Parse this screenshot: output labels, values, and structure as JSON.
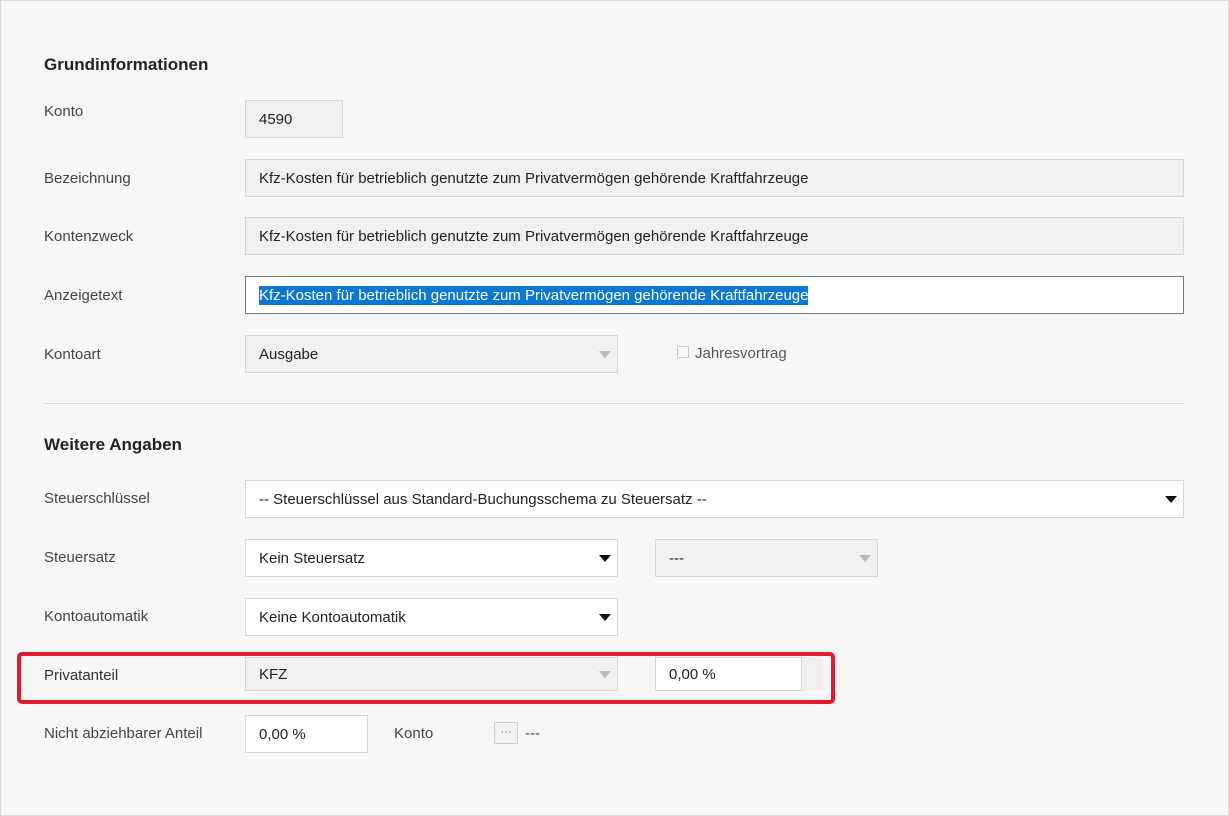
{
  "sections": {
    "grund": "Grundinformationen",
    "weitere": "Weitere Angaben"
  },
  "grund": {
    "konto": {
      "label": "Konto",
      "value": "4590"
    },
    "bezeichnung": {
      "label": "Bezeichnung",
      "value": "Kfz-Kosten für betrieblich genutzte zum Privatvermögen gehörende Kraftfahrzeuge"
    },
    "kontenzweck": {
      "label": "Kontenzweck",
      "value": "Kfz-Kosten für betrieblich genutzte zum Privatvermögen gehörende Kraftfahrzeuge"
    },
    "anzeigetext": {
      "label": "Anzeigetext",
      "value": "Kfz-Kosten für betrieblich genutzte zum Privatvermögen gehörende Kraftfahrzeuge"
    },
    "kontoart": {
      "label": "Kontoart",
      "value": "Ausgabe"
    },
    "jahresvortrag": {
      "label": "Jahresvortrag",
      "checked": false
    }
  },
  "weitere": {
    "steuerschluessel": {
      "label": "Steuerschlüssel",
      "value": "-- Steuerschlüssel aus Standard-Buchungsschema zu Steuersatz --"
    },
    "steuersatz": {
      "label": "Steuersatz",
      "value": "Kein Steuersatz",
      "secondary_value": "---"
    },
    "kontoautomatik": {
      "label": "Kontoautomatik",
      "value": "Keine Kontoautomatik"
    },
    "privatanteil": {
      "label": "Privatanteil",
      "value": "KFZ",
      "percent": "0,00 %"
    },
    "nicht_abziehbar": {
      "label": "Nicht abziehbarer Anteil",
      "value": "0,00 %"
    },
    "konto": {
      "label": "Konto",
      "button": "···",
      "value": "---"
    }
  },
  "colors": {
    "highlight": "#e01b2c",
    "selection": "#0a78d4"
  }
}
